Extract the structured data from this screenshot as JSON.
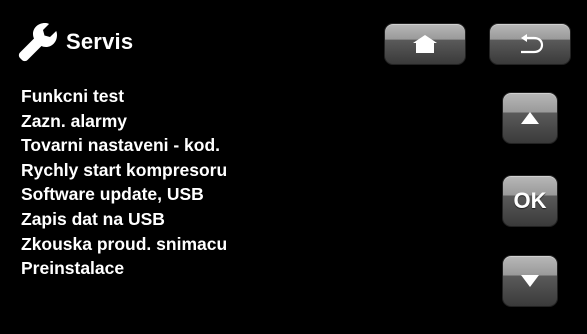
{
  "header": {
    "title": "Servis",
    "icon": "wrench-icon"
  },
  "nav": {
    "home_icon": "home-icon",
    "back_icon": "back-arrow-icon"
  },
  "menu": {
    "items": [
      {
        "label": "Funkcni test"
      },
      {
        "label": "Zazn. alarmy"
      },
      {
        "label": "Tovarni nastaveni - kod."
      },
      {
        "label": "Rychly start kompresoru"
      },
      {
        "label": "Software update, USB"
      },
      {
        "label": "Zapis dat na USB"
      },
      {
        "label": "Zkouska proud. snimacu"
      },
      {
        "label": "Preinstalace"
      }
    ]
  },
  "controls": {
    "up_icon": "up-arrow-icon",
    "ok_label": "OK",
    "down_icon": "down-arrow-icon"
  },
  "colors": {
    "background": "#000000",
    "text": "#ffffff",
    "button_top": "#b8b8b8",
    "button_bottom": "#3a3a3a"
  }
}
